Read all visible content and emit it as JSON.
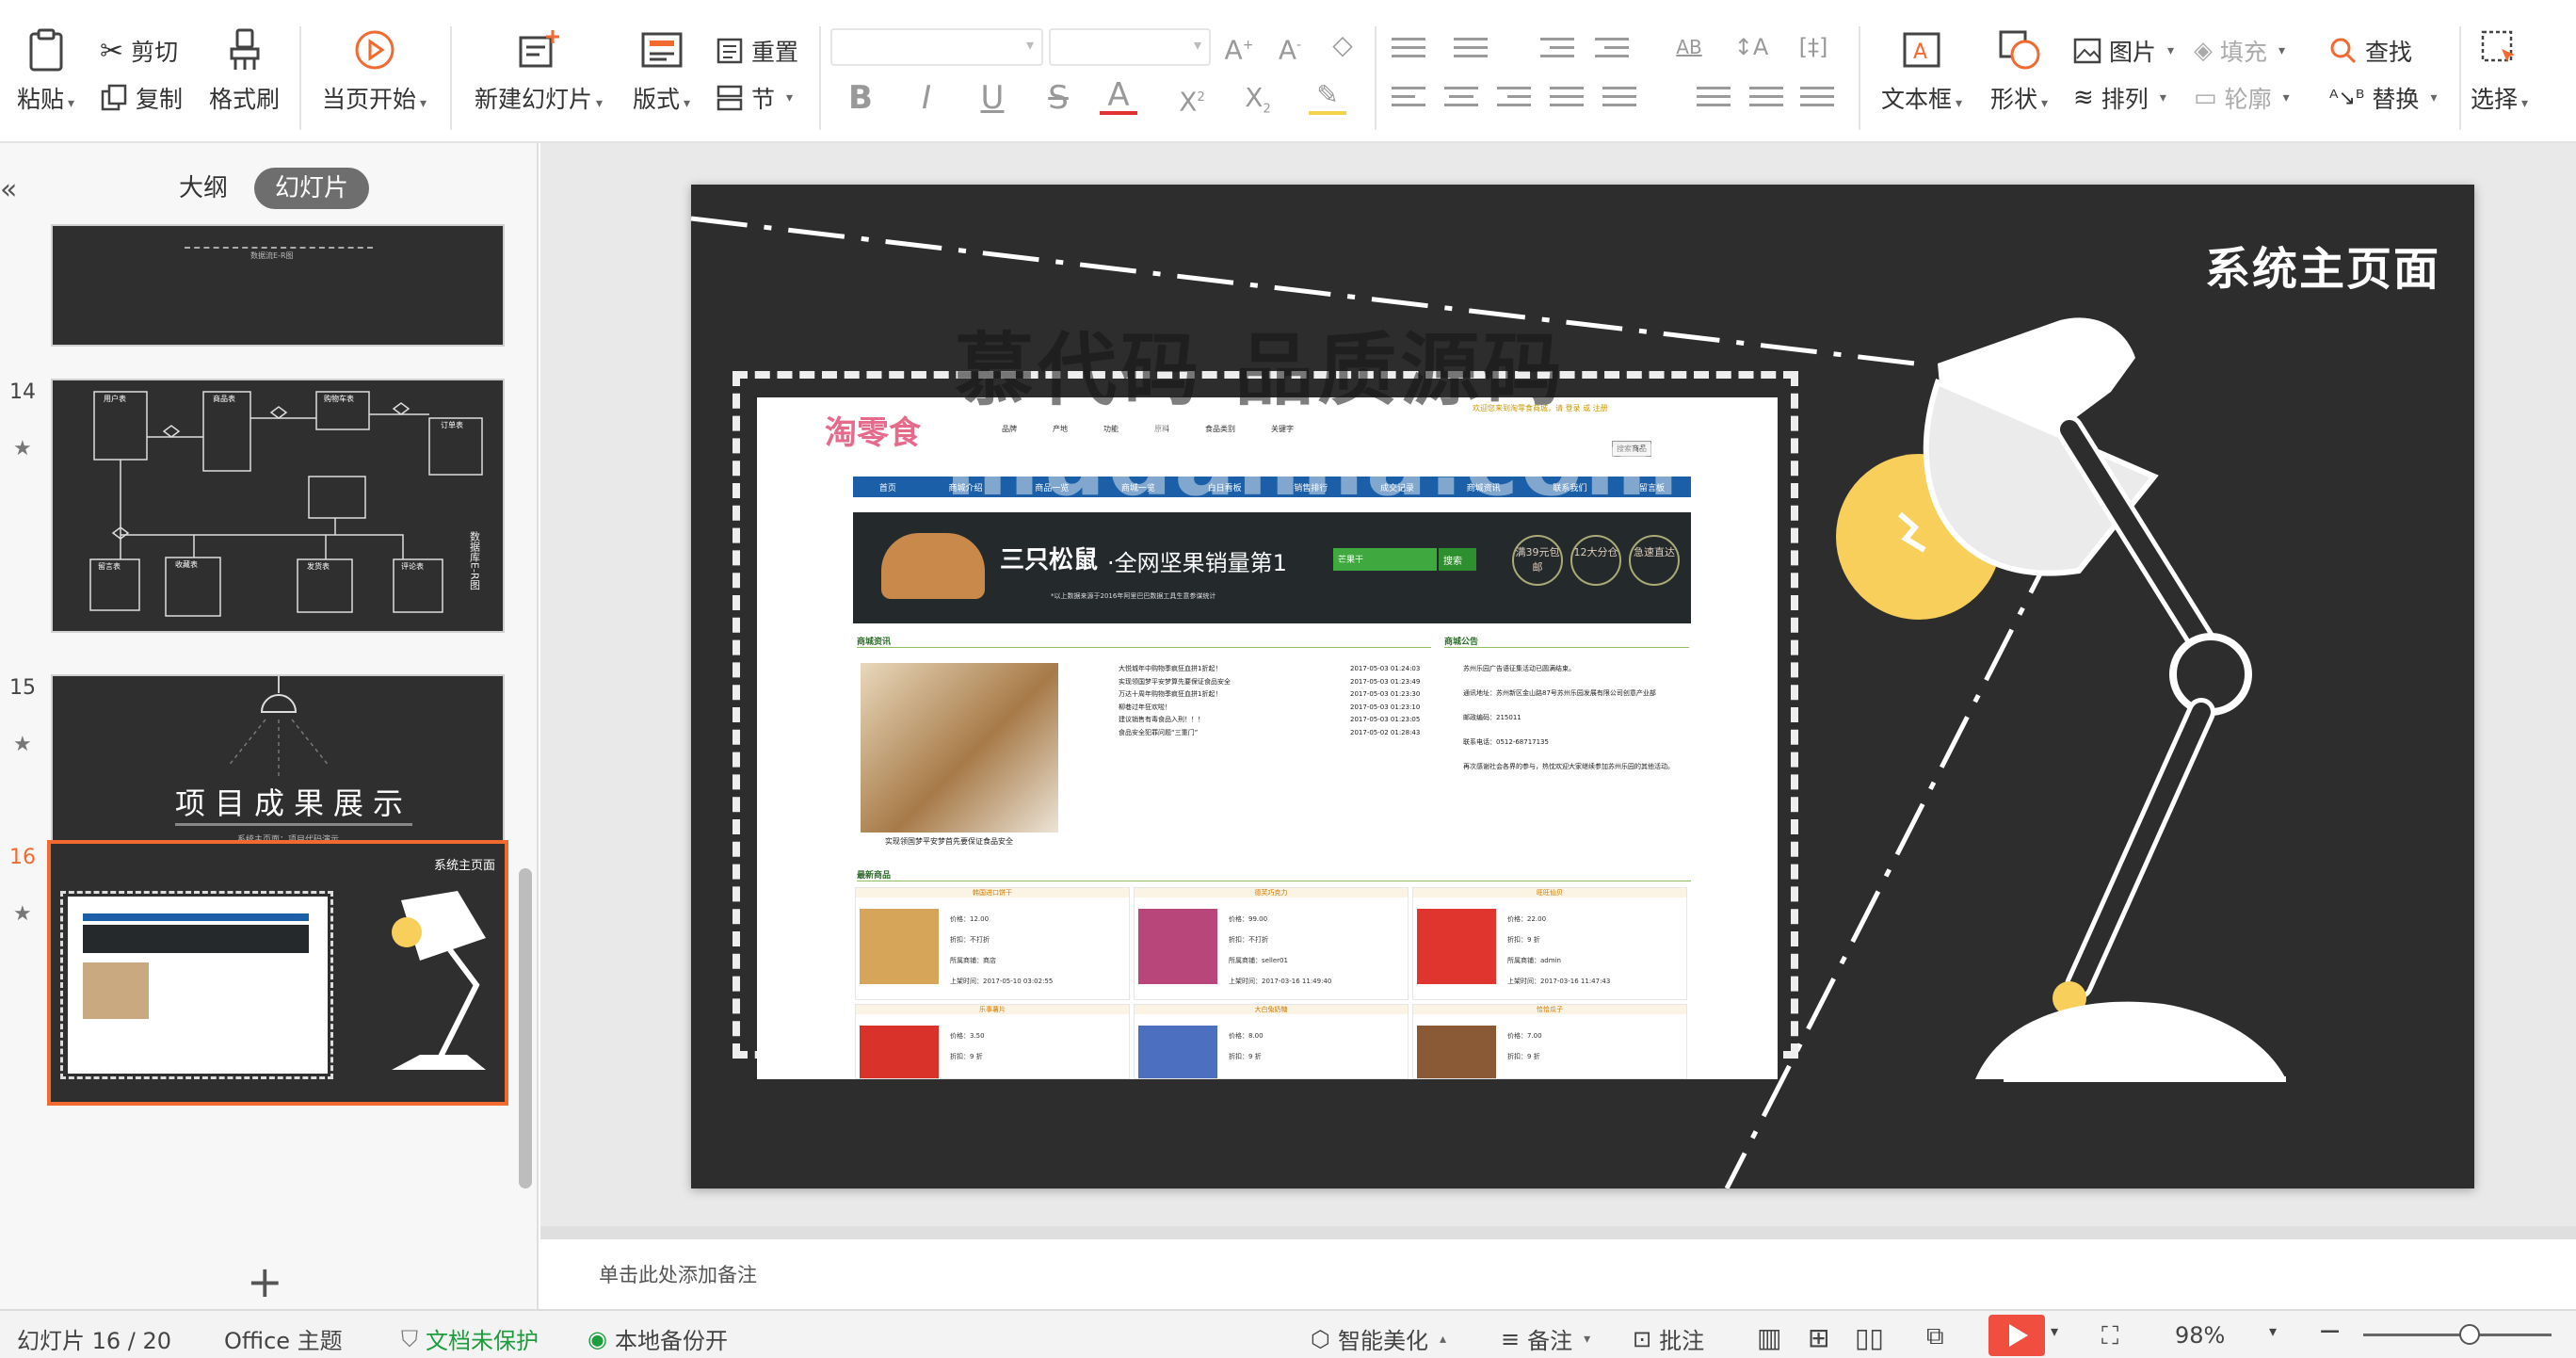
{
  "toolbar": {
    "paste": "粘贴",
    "cut": "剪切",
    "copy": "复制",
    "format_painter": "格式刷",
    "start_from_current": "当页开始",
    "new_slide": "新建幻灯片",
    "layout": "版式",
    "reset": "重置",
    "section": "节",
    "text_box": "文本框",
    "shape": "形状",
    "picture": "图片",
    "arrange": "排列",
    "fill": "填充",
    "outline": "轮廓",
    "find": "查找",
    "replace": "替换",
    "select": "选择"
  },
  "sidebar": {
    "tab_outline": "大纲",
    "tab_slides": "幻灯片",
    "slides": [
      {
        "number": "",
        "title": "数据流E-R图"
      },
      {
        "number": "14",
        "label": "数据库E-R图",
        "entities": [
          "用户表",
          "商品表",
          "购物车表",
          "订单表",
          "留言表",
          "收藏表",
          "发货表",
          "评论表"
        ]
      },
      {
        "number": "15",
        "title": "项目成果展示",
        "subtitle": "系统主页面：项目代码演示"
      },
      {
        "number": "16",
        "title": "系统主页面"
      }
    ]
  },
  "slide": {
    "title": "系统主页面",
    "watermark_top": "慕代码 品质源码",
    "watermark_bottom": "mudaima.com",
    "website": {
      "logo": "淘零食",
      "welcome": "欢迎您来到淘零食商城，请 登录 或 注册",
      "search_button": "搜索商品",
      "filters": [
        "品牌",
        "产地",
        "功能",
        "原料",
        "食品类别",
        "关键字"
      ],
      "nav": [
        "首页",
        "商城介绍",
        "商品一览",
        "商城一览",
        "白日看板",
        "销售排行",
        "成交记录",
        "商城资讯",
        "联系我们",
        "留言板"
      ],
      "banner_brand": "三只松鼠",
      "banner_text": "·全网坚果销量第1",
      "banner_sub": "*以上数据来源于2016年阿里巴巴数据工具生意参谋统计",
      "banner_search_placeholder": "芒果干",
      "banner_search_btn": "搜索",
      "banner_badges": [
        "满39元包邮",
        "12大分仓",
        "急速直达"
      ],
      "section_news": "商城资讯",
      "section_notice": "商城公告",
      "section_new": "最新商品",
      "news": [
        {
          "title": "大悦城年中购物季疯狂血拼1折起！",
          "date": "2017-05-03 01:24:03"
        },
        {
          "title": "实现领国梦平安梦算先要保证食品安全",
          "date": "2017-05-03 01:23:49"
        },
        {
          "title": "万达十周年购物季疯狂血拼1折起！",
          "date": "2017-05-03 01:23:30"
        },
        {
          "title": "柳巷过年狂欢啦！",
          "date": "2017-05-03 01:23:10"
        },
        {
          "title": "建议销售有毒食品入刑！！！",
          "date": "2017-05-03 01:23:05"
        },
        {
          "title": "食品安全犯罪问题“三重门”",
          "date": "2017-05-02 01:28:43"
        }
      ],
      "news_caption": "实现领国梦平安梦首先要保证食品安全",
      "notice": [
        "苏州乐园广告语征集活动已圆满结束。",
        "通讯地址：苏州新区金山路87号苏州乐园发展有限公司创意产业部",
        "邮政编码：215011",
        "联系电话：0512-68717135",
        "再次感谢社会各界的参与，热忱欢迎大家继续参加苏州乐园的其他活动。"
      ],
      "products": [
        {
          "name": "韩国进口饼干",
          "price": "价格：12.00",
          "discount": "折扣：不打折",
          "shop": "所属商铺：商店",
          "date": "上架时间：2017-05-10 03:02:55"
        },
        {
          "name": "德芙巧克力",
          "price": "价格：99.00",
          "discount": "折扣：不打折",
          "shop": "所属商铺：seller01",
          "date": "上架时间：2017-03-16 11:49:40"
        },
        {
          "name": "旺旺仙贝",
          "price": "价格：22.00",
          "discount": "折扣：9 折",
          "shop": "所属商铺：admin",
          "date": "上架时间：2017-03-16 11:47:43"
        },
        {
          "name": "乐事薯片",
          "price": "价格：3.50",
          "discount": "折扣：9 折"
        },
        {
          "name": "大白兔奶糖",
          "price": "价格：8.00",
          "discount": "折扣：9 折"
        },
        {
          "name": "恰恰瓜子",
          "price": "价格：7.00",
          "discount": "折扣：9 折"
        }
      ]
    }
  },
  "notes": {
    "placeholder": "单击此处添加备注"
  },
  "status": {
    "slide_count": "幻灯片 16 / 20",
    "theme": "Office 主题",
    "doc_protect": "文档未保护",
    "backup": "本地备份开",
    "beautify": "智能美化",
    "notes": "备注",
    "comment": "批注",
    "zoom": "98%"
  },
  "colors": {
    "accent": "#f26a30",
    "play": "#f04e3e",
    "chalkboard": "#2d2d2d",
    "lamp_bulb": "#f7cf5a",
    "protect_green": "#1a9e3c"
  }
}
